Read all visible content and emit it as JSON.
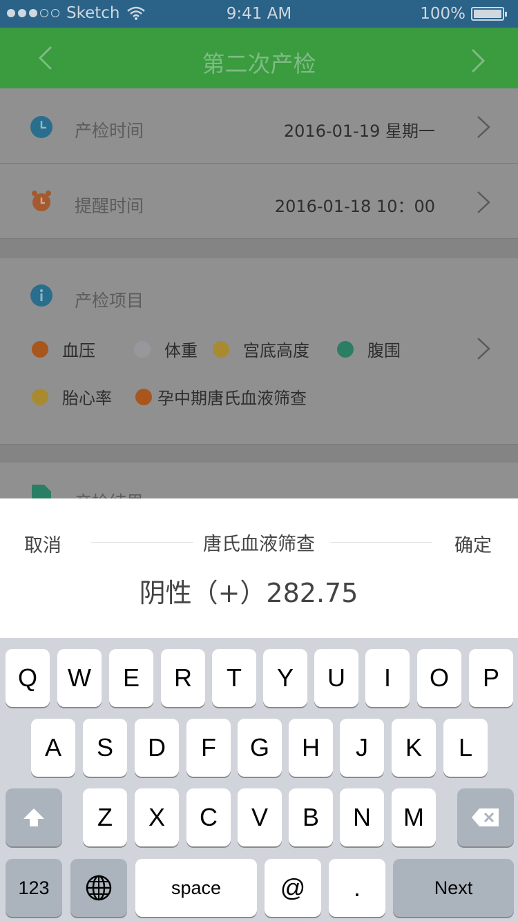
{
  "status_bar": {
    "carrier": "Sketch",
    "time": "9:41 AM",
    "battery": "100%"
  },
  "nav": {
    "title": "第二次产检",
    "back_icon": "chevron-left-icon",
    "next_icon": "chevron-right-icon"
  },
  "rows": {
    "exam_time": {
      "label": "产检时间",
      "value": "2016-01-19 星期一",
      "icon": "clock-icon",
      "icon_color": "#2a84a8"
    },
    "reminder_time": {
      "label": "提醒时间",
      "value": "2016-01-18 10：00",
      "icon": "alarm-clock-icon",
      "icon_color": "#c96435"
    },
    "exam_items": {
      "label": "产检项目",
      "icon": "info-icon",
      "icon_color": "#2a84a8",
      "items": [
        {
          "label": "血压",
          "color": "#b2611f"
        },
        {
          "label": "体重",
          "color": "#a8a4ab"
        },
        {
          "label": "宫底高度",
          "color": "#b89935"
        },
        {
          "label": "腹围",
          "color": "#2d8a6e"
        },
        {
          "label": "胎心率",
          "color": "#b89935"
        },
        {
          "label": "孕中期唐氏血液筛查",
          "color": "#b85e1f"
        }
      ]
    },
    "exam_result": {
      "label": "产检结果",
      "icon": "document-icon",
      "icon_color": "#2d8a6e"
    }
  },
  "picker": {
    "cancel": "取消",
    "title": "唐氏血液筛查",
    "confirm": "确定",
    "value": "阴性（+）282.75"
  },
  "keyboard": {
    "row1": [
      "Q",
      "W",
      "E",
      "R",
      "T",
      "Y",
      "U",
      "I",
      "O",
      "P"
    ],
    "row2": [
      "A",
      "S",
      "D",
      "F",
      "G",
      "H",
      "J",
      "K",
      "L"
    ],
    "row3": [
      "Z",
      "X",
      "C",
      "V",
      "B",
      "N",
      "M"
    ],
    "numbers_label": "123",
    "space_label": "space",
    "at_label": "@",
    "dot_label": ".",
    "next_label": "Next",
    "shift_icon": "shift-icon",
    "globe_icon": "globe-icon",
    "delete_icon": "backspace-icon"
  },
  "colors": {
    "status_bar": "#2a6288",
    "nav_bar": "#3a9b3f",
    "overlay_bg": "#8c8c8c"
  }
}
